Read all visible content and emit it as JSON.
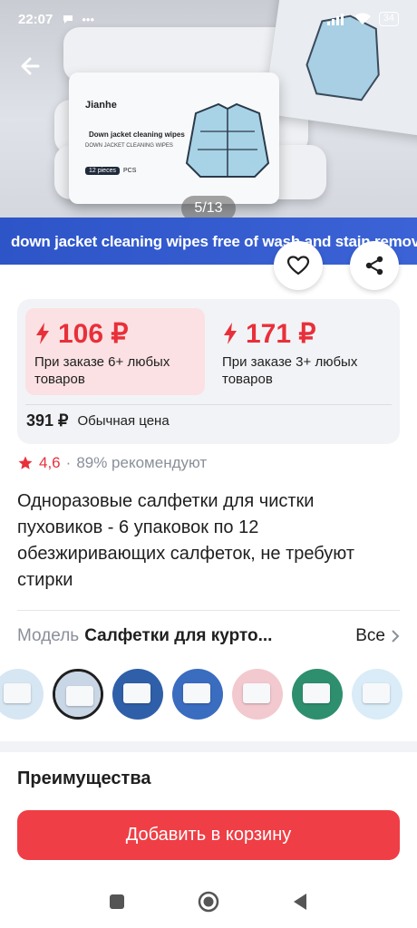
{
  "status_bar": {
    "time": "22:07",
    "battery": "34"
  },
  "hero": {
    "banner_text": "down jacket cleaning wipes free of wash and stain removal",
    "counter": "5/13",
    "package": {
      "brand": "Jianhe",
      "title": "Down jacket cleaning wipes",
      "subtitle": "DOWN JACKET CLEANING WIPES",
      "pieces": "12 pieces",
      "pcs": "PCS"
    }
  },
  "price": {
    "tiers": [
      {
        "price": "106 ₽",
        "condition": "При заказе 6+ любых товаров"
      },
      {
        "price": "171 ₽",
        "condition": "При заказе 3+ любых товаров"
      }
    ],
    "regular_price": "391 ₽",
    "regular_label": "Обычная цена"
  },
  "rating": {
    "score": "4,6",
    "separator": "·",
    "recommend": "89% рекомендуют"
  },
  "product_title": "Одноразовые салфетки для чистки пуховиков - 6 упаковок по 12 обезжиривающих салфеток, не требуют стирки",
  "model": {
    "label": "Модель",
    "value": "Салфетки для курто...",
    "all": "Все"
  },
  "thumbnails": [
    {
      "bg": "#d7e6f3"
    },
    {
      "bg": "#c9d6e6",
      "selected": true
    },
    {
      "bg": "#2f5fa8"
    },
    {
      "bg": "#3a6cc0"
    },
    {
      "bg": "#f2c9cf"
    },
    {
      "bg": "#2d8f6e"
    },
    {
      "bg": "#d9ecf7"
    }
  ],
  "advantages_title": "Преимущества",
  "cart_button": "Добавить в корзину",
  "colors": {
    "accent": "#ef3e45",
    "price_red": "#e8303a",
    "banner": "#3b63d6"
  }
}
